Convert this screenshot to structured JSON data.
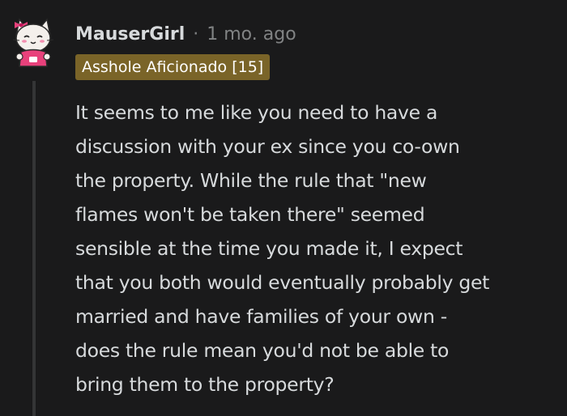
{
  "comment": {
    "author": "MauserGirl",
    "separator": "·",
    "timestamp": "1 mo. ago",
    "flair": "Asshole Aficionado [15]",
    "flair_color": "#7a6428",
    "avatar": {
      "icon": "cartoon-cat-avatar-icon",
      "accent_color": "#e8417b"
    },
    "body": "It seems to me like you need to have a\ndiscussion with your ex since you co-own\nthe property. While the rule that \"new\nflames won't be taken there\" seemed\nsensible at the time you made it, I expect\nthat you both would eventually probably get\nmarried and have families of your own -\ndoes the rule mean you'd not be able to\nbring them to the property?"
  }
}
